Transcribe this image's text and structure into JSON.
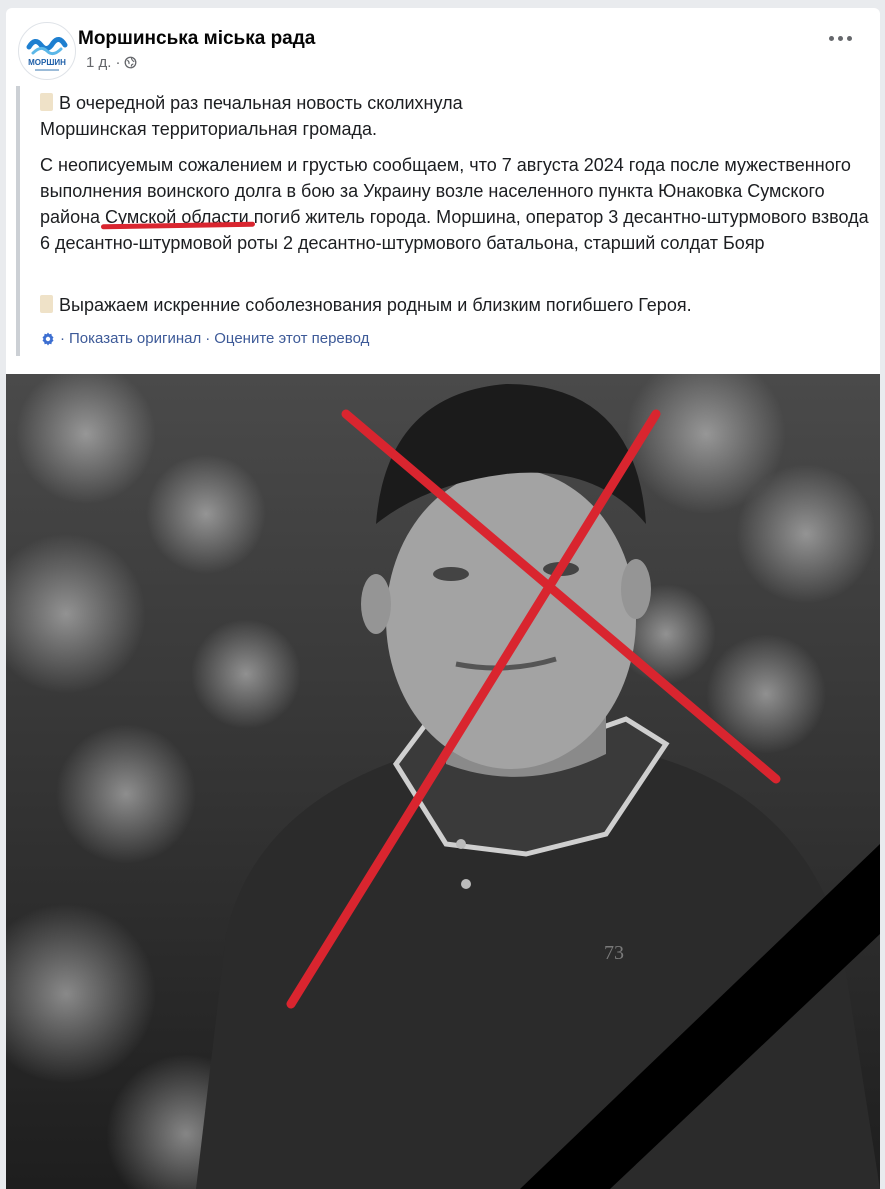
{
  "header": {
    "page_name": "Моршинська міська рада",
    "time": "1 д.",
    "privacy_icon": "globe-icon",
    "more_icon": "more-dots-icon",
    "logo_text": "МОРШИН"
  },
  "post": {
    "line1": "В очередной раз печальная новость сколихнула",
    "line2": "Моршинская территориальная громада.",
    "p2_part1": "С неописуемым сожалением и грустью сообщаем, что 7 августа 2024 года после мужественного выполнения воинского долга в бою за Украину возле населенного пункта Юнаковка Сумского района ",
    "p2_highlight": "Сумской области",
    "p2_part2": " погиб житель города. Моршина, оператор 3 десантно-штурмового взвода 6 десантно-штурмовой роты 2 десантно-штурмового батальона, старший солдат Бояр",
    "p3": "Выражаем искренние соболезнования родным и близким погибшего Героя."
  },
  "translation": {
    "show_original": "Показать оригинал",
    "rate": "Оцените этот перевод",
    "separator": "·"
  },
  "photo": {
    "badge_text": "73"
  },
  "colors": {
    "accent_red": "#d9252f",
    "link": "#3d5a98"
  }
}
